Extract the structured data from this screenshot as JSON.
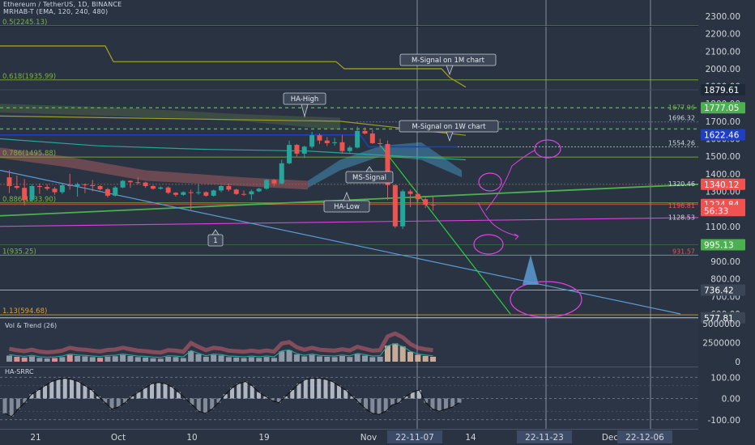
{
  "header": {
    "title": "Ethereum / TetherUS, 1D, BINANCE",
    "indicator": "MRHAB-T (EMA, 120, 240, 480)"
  },
  "colors": {
    "background": "#2a3342",
    "bull": "#26a69a",
    "bear": "#ef5350",
    "green_line": "#4caf50",
    "blue_line": "#1e3fbf",
    "magenta": "#e040e0",
    "fib_green": "#7cb342",
    "axis_text": "#d1d4dc"
  },
  "chart_data": [
    {
      "type": "line",
      "panel": "price",
      "ylim": [
        500,
        2350
      ],
      "y_ticks": [
        "2300.00",
        "2200.00",
        "2100.00",
        "2000.00",
        "1900.00",
        "1800.00",
        "1700.00",
        "1600.00",
        "1500.00",
        "1400.00",
        "1300.00",
        "1200.00",
        "1100.00",
        "1000.00",
        "900.00",
        "800.00",
        "700.00",
        "600.00"
      ],
      "x_ticks": [
        "21",
        "Oct",
        "10",
        "19",
        "Nov",
        "22-11-07",
        "14",
        "22-11-23",
        "Dec",
        "22-12-06"
      ],
      "price_labels": [
        {
          "text": "1879.61",
          "value": 1879.61,
          "color": "#1e2a3a"
        },
        {
          "text": "1777.05",
          "value": 1777.05,
          "color": "#4caf50"
        },
        {
          "text": "1622.46",
          "value": 1622.46,
          "color": "#1e3fbf"
        },
        {
          "text": "1340.12",
          "value": 1340.12,
          "color": "#ef5350"
        },
        {
          "text": "1224.84",
          "value": 1224.84,
          "color": "#ef5350"
        },
        {
          "text": "56:33",
          "value": 1190,
          "color": "#ef5350"
        },
        {
          "text": "995.13",
          "value": 995.13,
          "color": "#4caf50"
        },
        {
          "text": "736.42",
          "value": 736.42,
          "color": "#3a4556"
        },
        {
          "text": "577.81",
          "value": 577.81,
          "color": "#3a4556"
        }
      ],
      "fib_levels": [
        {
          "text": "0.5(2245.13)",
          "value": 2245.13
        },
        {
          "text": "0.618(1935.99)",
          "value": 1935.99
        },
        {
          "text": "0.786(1495.88)",
          "value": 1495.88
        },
        {
          "text": "0.886(1233.90)",
          "value": 1233.9
        },
        {
          "text": "1(935.25)",
          "value": 935.25
        },
        {
          "text": "1.13(594.68)",
          "value": 594.68
        }
      ],
      "level_texts": [
        {
          "text": "1696.32",
          "value": 1696.32
        },
        {
          "text": "1554.26",
          "value": 1554.26
        },
        {
          "text": "1320.46",
          "value": 1320.46
        },
        {
          "text": "1196.81",
          "value": 1196.81
        },
        {
          "text": "1128.53",
          "value": 1128.53
        },
        {
          "text": "1677.96",
          "value": 1757
        },
        {
          "text": "931.57",
          "value": 935
        }
      ],
      "annotations": [
        {
          "text": "M-Signal on 1M chart"
        },
        {
          "text": "HA-High"
        },
        {
          "text": "M-Signal on 1W chart"
        },
        {
          "text": "MS-Signal"
        },
        {
          "text": "HA-Low"
        },
        {
          "text": "1"
        }
      ],
      "candles": [
        {
          "x": "Sep 19",
          "o": 1380,
          "h": 1420,
          "l": 1290,
          "c": 1330
        },
        {
          "x": "Sep 20",
          "o": 1330,
          "h": 1390,
          "l": 1310,
          "c": 1320
        },
        {
          "x": "Sep 21",
          "o": 1320,
          "h": 1370,
          "l": 1220,
          "c": 1250
        },
        {
          "x": "Sep 22",
          "o": 1250,
          "h": 1340,
          "l": 1240,
          "c": 1330
        },
        {
          "x": "Sep 23",
          "o": 1330,
          "h": 1345,
          "l": 1285,
          "c": 1325
        },
        {
          "x": "Sep 24",
          "o": 1325,
          "h": 1340,
          "l": 1305,
          "c": 1315
        },
        {
          "x": "Sep 25",
          "o": 1315,
          "h": 1325,
          "l": 1280,
          "c": 1295
        },
        {
          "x": "Sep 26",
          "o": 1295,
          "h": 1340,
          "l": 1285,
          "c": 1335
        },
        {
          "x": "Sep 27",
          "o": 1335,
          "h": 1400,
          "l": 1310,
          "c": 1330
        },
        {
          "x": "Sep 28",
          "o": 1330,
          "h": 1350,
          "l": 1270,
          "c": 1340
        },
        {
          "x": "Sep 29",
          "o": 1340,
          "h": 1345,
          "l": 1290,
          "c": 1335
        },
        {
          "x": "Sep 30",
          "o": 1335,
          "h": 1365,
          "l": 1300,
          "c": 1330
        },
        {
          "x": "Oct 1",
          "o": 1330,
          "h": 1335,
          "l": 1305,
          "c": 1312
        },
        {
          "x": "Oct 2",
          "o": 1312,
          "h": 1320,
          "l": 1265,
          "c": 1275
        },
        {
          "x": "Oct 3",
          "o": 1275,
          "h": 1330,
          "l": 1270,
          "c": 1322
        },
        {
          "x": "Oct 4",
          "o": 1322,
          "h": 1365,
          "l": 1318,
          "c": 1360
        },
        {
          "x": "Oct 5",
          "o": 1360,
          "h": 1362,
          "l": 1320,
          "c": 1352
        },
        {
          "x": "Oct 6",
          "o": 1352,
          "h": 1380,
          "l": 1340,
          "c": 1350
        },
        {
          "x": "Oct 7",
          "o": 1350,
          "h": 1355,
          "l": 1320,
          "c": 1330
        },
        {
          "x": "Oct 8",
          "o": 1330,
          "h": 1335,
          "l": 1310,
          "c": 1315
        },
        {
          "x": "Oct 9",
          "o": 1315,
          "h": 1328,
          "l": 1310,
          "c": 1322
        },
        {
          "x": "Oct 10",
          "o": 1322,
          "h": 1328,
          "l": 1285,
          "c": 1292
        },
        {
          "x": "Oct 11",
          "o": 1292,
          "h": 1295,
          "l": 1270,
          "c": 1280
        },
        {
          "x": "Oct 12",
          "o": 1280,
          "h": 1300,
          "l": 1275,
          "c": 1295
        },
        {
          "x": "Oct 13",
          "o": 1295,
          "h": 1310,
          "l": 1195,
          "c": 1290
        },
        {
          "x": "Oct 14",
          "o": 1290,
          "h": 1340,
          "l": 1280,
          "c": 1295
        },
        {
          "x": "Oct 15",
          "o": 1295,
          "h": 1300,
          "l": 1270,
          "c": 1275
        },
        {
          "x": "Oct 16",
          "o": 1275,
          "h": 1310,
          "l": 1270,
          "c": 1305
        },
        {
          "x": "Oct 17",
          "o": 1305,
          "h": 1335,
          "l": 1295,
          "c": 1330
        },
        {
          "x": "Oct 18",
          "o": 1330,
          "h": 1345,
          "l": 1300,
          "c": 1310
        },
        {
          "x": "Oct 19",
          "o": 1310,
          "h": 1315,
          "l": 1280,
          "c": 1285
        },
        {
          "x": "Oct 20",
          "o": 1285,
          "h": 1305,
          "l": 1275,
          "c": 1283
        },
        {
          "x": "Oct 21",
          "o": 1283,
          "h": 1310,
          "l": 1250,
          "c": 1300
        },
        {
          "x": "Oct 22",
          "o": 1300,
          "h": 1320,
          "l": 1295,
          "c": 1315
        },
        {
          "x": "Oct 23",
          "o": 1315,
          "h": 1370,
          "l": 1310,
          "c": 1365
        },
        {
          "x": "Oct 24",
          "o": 1365,
          "h": 1370,
          "l": 1330,
          "c": 1345
        },
        {
          "x": "Oct 25",
          "o": 1345,
          "h": 1480,
          "l": 1340,
          "c": 1460
        },
        {
          "x": "Oct 26",
          "o": 1460,
          "h": 1590,
          "l": 1455,
          "c": 1565
        },
        {
          "x": "Oct 27",
          "o": 1565,
          "h": 1570,
          "l": 1500,
          "c": 1515
        },
        {
          "x": "Oct 28",
          "o": 1515,
          "h": 1560,
          "l": 1490,
          "c": 1555
        },
        {
          "x": "Oct 29",
          "o": 1555,
          "h": 1640,
          "l": 1545,
          "c": 1620
        },
        {
          "x": "Oct 30",
          "o": 1620,
          "h": 1630,
          "l": 1570,
          "c": 1590
        },
        {
          "x": "Oct 31",
          "o": 1590,
          "h": 1610,
          "l": 1560,
          "c": 1575
        },
        {
          "x": "Nov 1",
          "o": 1575,
          "h": 1605,
          "l": 1560,
          "c": 1580
        },
        {
          "x": "Nov 2",
          "o": 1580,
          "h": 1620,
          "l": 1515,
          "c": 1530
        },
        {
          "x": "Nov 3",
          "o": 1530,
          "h": 1560,
          "l": 1520,
          "c": 1550
        },
        {
          "x": "Nov 4",
          "o": 1550,
          "h": 1670,
          "l": 1545,
          "c": 1645
        },
        {
          "x": "Nov 5",
          "o": 1645,
          "h": 1665,
          "l": 1625,
          "c": 1630
        },
        {
          "x": "Nov 6",
          "o": 1630,
          "h": 1650,
          "l": 1570,
          "c": 1575
        },
        {
          "x": "Nov 7",
          "o": 1575,
          "h": 1600,
          "l": 1550,
          "c": 1570
        },
        {
          "x": "Nov 8",
          "o": 1570,
          "h": 1590,
          "l": 1250,
          "c": 1335
        },
        {
          "x": "Nov 9",
          "o": 1335,
          "h": 1340,
          "l": 1090,
          "c": 1100
        },
        {
          "x": "Nov 10",
          "o": 1100,
          "h": 1310,
          "l": 1085,
          "c": 1300
        },
        {
          "x": "Nov 11",
          "o": 1300,
          "h": 1310,
          "l": 1210,
          "c": 1285
        },
        {
          "x": "Nov 12",
          "o": 1285,
          "h": 1290,
          "l": 1240,
          "c": 1255
        },
        {
          "x": "Nov 13",
          "o": 1255,
          "h": 1265,
          "l": 1205,
          "c": 1225
        },
        {
          "x": "Nov 14",
          "o": 1225,
          "h": 1270,
          "l": 1190,
          "c": 1224.84
        }
      ]
    },
    {
      "type": "bar",
      "panel": "volume",
      "title": "Vol & Trend (26)",
      "ylim": [
        0,
        5000000
      ],
      "y_ticks": [
        "5000000",
        "2500000",
        "0"
      ],
      "values": [
        800000,
        650000,
        550000,
        700000,
        500000,
        420000,
        480000,
        600000,
        900000,
        750000,
        700000,
        600000,
        520000,
        680000,
        720000,
        900000,
        750000,
        600000,
        550000,
        450000,
        400000,
        650000,
        600000,
        480000,
        1400000,
        1000000,
        650000,
        900000,
        820000,
        600000,
        550000,
        480000,
        600000,
        500000,
        620000,
        500000,
        1350000,
        1500000,
        950000,
        700000,
        900000,
        700000,
        650000,
        600000,
        750000,
        620000,
        1000000,
        800000,
        600000,
        650000,
        2100000,
        2400000,
        2000000,
        1300000,
        900000,
        750000,
        650000
      ],
      "bar_colors": [
        "#9aa3b0",
        "#ef9a9a",
        "#ef9a9a",
        "#9aa3b0",
        "#9aa3b0",
        "#9aa3b0",
        "#ef9a9a",
        "#9aa3b0",
        "#ef9a9a",
        "#9aa3b0",
        "#9aa3b0",
        "#9aa3b0",
        "#ef9a9a",
        "#9aa3b0",
        "#9aa3b0",
        "#9aa3b0",
        "#9aa3b0",
        "#9aa3b0",
        "#9aa3b0",
        "#9aa3b0",
        "#9aa3b0",
        "#9aa3b0",
        "#9aa3b0",
        "#9aa3b0",
        "#9aa3b0",
        "#9aa3b0",
        "#9aa3b0",
        "#9aa3b0",
        "#9aa3b0",
        "#9aa3b0",
        "#9aa3b0",
        "#9aa3b0",
        "#9aa3b0",
        "#9aa3b0",
        "#9aa3b0",
        "#9aa3b0",
        "#9aa3b0",
        "#9aa3b0",
        "#9aa3b0",
        "#9aa3b0",
        "#9aa3b0",
        "#9aa3b0",
        "#9aa3b0",
        "#9aa3b0",
        "#9aa3b0",
        "#9aa3b0",
        "#9aa3b0",
        "#9aa3b0",
        "#9aa3b0",
        "#9aa3b0",
        "#d7b9a0",
        "#d7b9a0",
        "#d7b9a0",
        "#d7b9a0",
        "#d7b9a0",
        "#d7b9a0",
        "#d7b9a0"
      ]
    },
    {
      "type": "bar",
      "panel": "oscillator",
      "title": "HA-SRRC",
      "ylim": [
        -120,
        120
      ],
      "y_ticks": [
        "100.00",
        "0.00",
        "-100.00"
      ],
      "values": [
        -70,
        -85,
        -50,
        -20,
        20,
        40,
        60,
        80,
        90,
        95,
        90,
        80,
        60,
        40,
        10,
        -20,
        -50,
        -40,
        -20,
        10,
        30,
        50,
        70,
        75,
        70,
        55,
        30,
        0,
        -30,
        -60,
        -70,
        -50,
        -20,
        20,
        50,
        70,
        80,
        60,
        30,
        10,
        -10,
        -20,
        10,
        40,
        70,
        90,
        95,
        95,
        90,
        80,
        60,
        40,
        10,
        -20,
        -50,
        -70,
        -75,
        -60,
        -30,
        -20,
        10,
        30,
        40,
        -20,
        -50,
        -60,
        -50,
        -40,
        -20
      ]
    }
  ]
}
